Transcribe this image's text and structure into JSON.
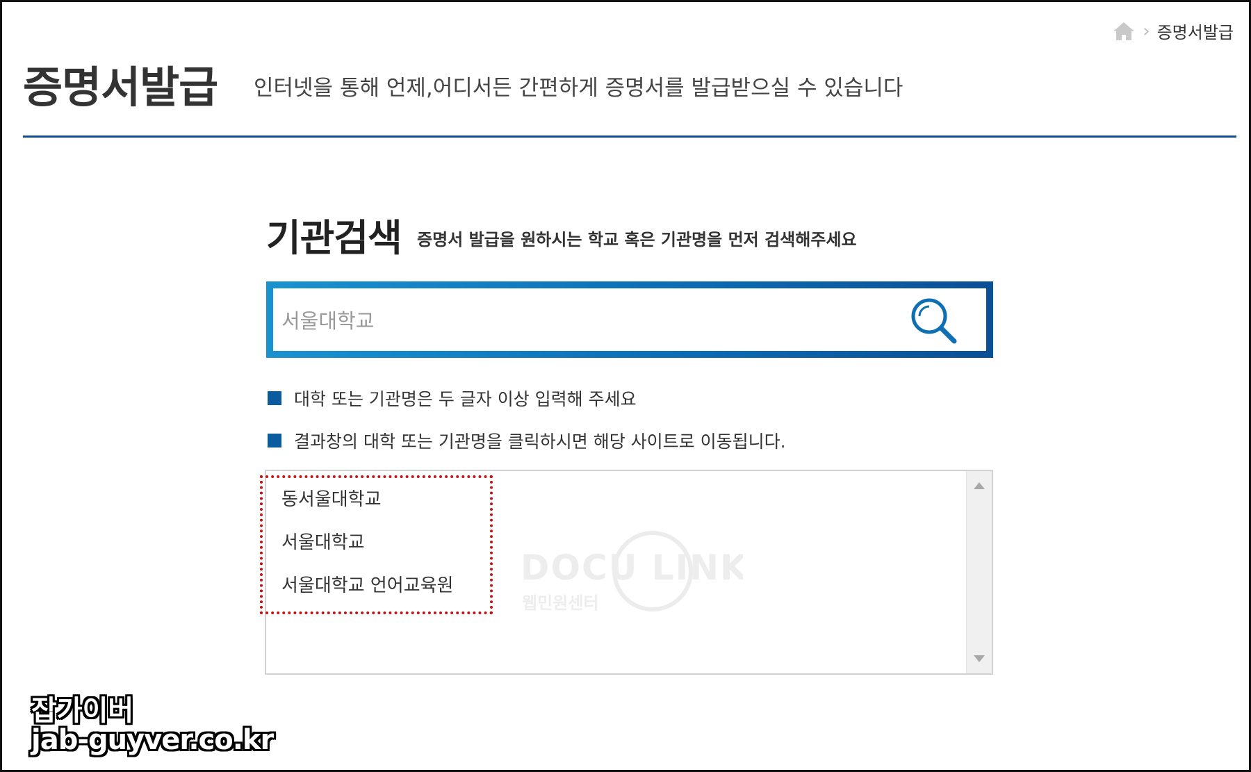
{
  "breadcrumb": {
    "home_icon": "home-icon",
    "separator": "›",
    "current": "증명서발급"
  },
  "header": {
    "title": "증명서발급",
    "description": "인터넷을 통해 언제,어디서든 간편하게 증명서를 발급받으실 수 있습니다"
  },
  "search": {
    "title": "기관검색",
    "subtitle": "증명서 발급을 원하시는 학교 혹은 기관명을 먼저 검색해주세요",
    "input_value": "서울대학교",
    "button_icon": "search-icon"
  },
  "notes": [
    "대학 또는 기관명은 두 글자 이상 입력해 주세요",
    "결과창의 대학 또는 기관명을 클릭하시면 해당 사이트로 이동됩니다."
  ],
  "results": {
    "items": [
      "동서울대학교",
      "서울대학교",
      "서울대학교 언어교육원"
    ],
    "watermark": {
      "logo_text": "DOCU LINK",
      "sub_text": "웹민원센터"
    }
  },
  "site_mark": {
    "name": "잡가이버",
    "url": "jab-guyver.co.kr"
  },
  "colors": {
    "accent": "#0b5b9f",
    "rule": "#0f4f8f",
    "highlight": "#c01515"
  }
}
